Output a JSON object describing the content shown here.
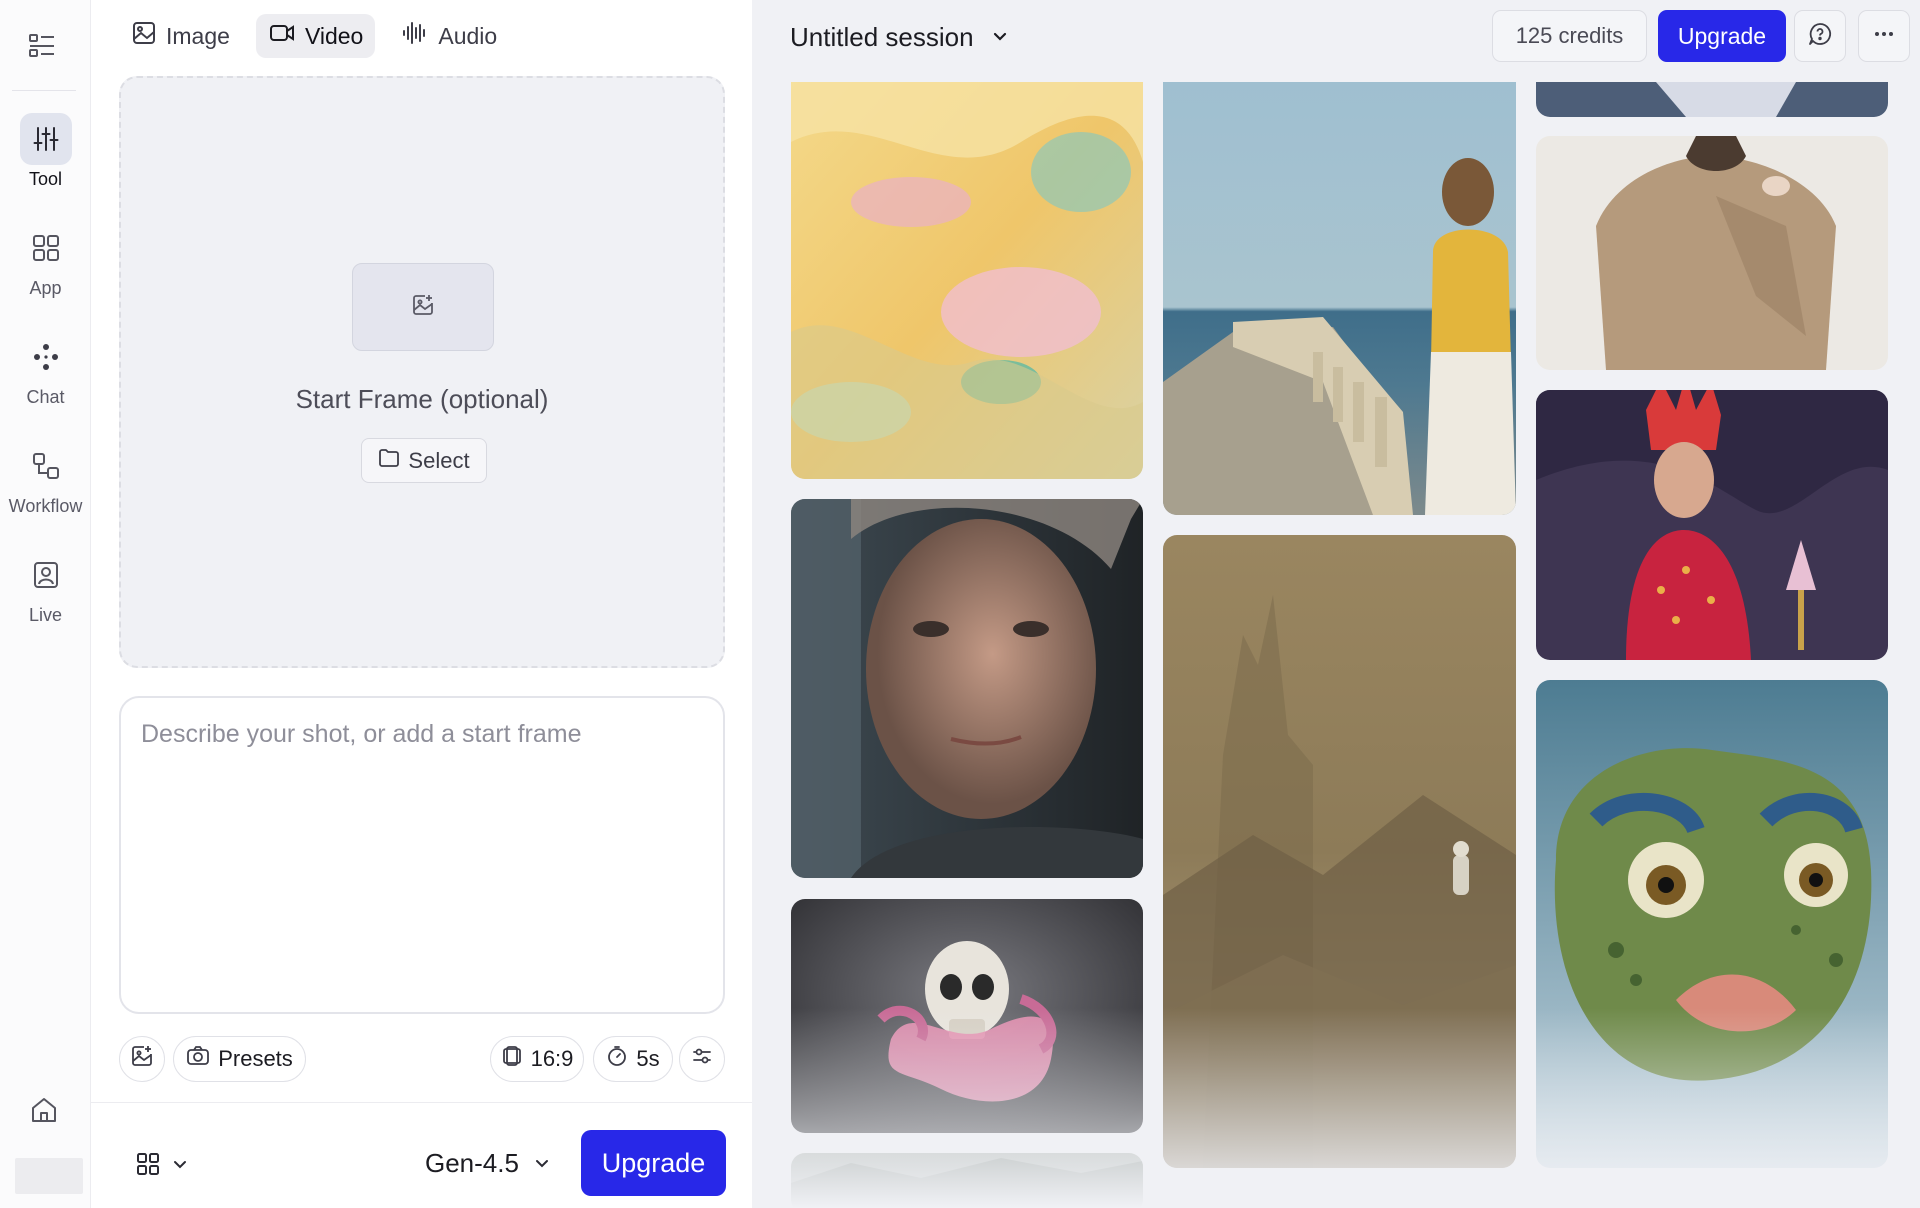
{
  "rail": {
    "toggle_icon": "sidebar-list-icon",
    "items": [
      {
        "label": "Tool",
        "icon": "sliders-icon",
        "active": true
      },
      {
        "label": "App",
        "icon": "grid-icon",
        "active": false
      },
      {
        "label": "Chat",
        "icon": "dots-icon",
        "active": false
      },
      {
        "label": "Workflow",
        "icon": "nodes-icon",
        "active": false
      },
      {
        "label": "Live",
        "icon": "portrait-icon",
        "active": false
      }
    ],
    "home_icon": "home-icon"
  },
  "panel": {
    "tabs": [
      {
        "label": "Image",
        "icon": "image-icon",
        "active": false
      },
      {
        "label": "Video",
        "icon": "video-icon",
        "active": true
      },
      {
        "label": "Audio",
        "icon": "waveform-icon",
        "active": false
      }
    ],
    "frame": {
      "label": "Start Frame (optional)",
      "select_label": "Select"
    },
    "prompt": {
      "placeholder": "Describe your shot, or add a start frame",
      "value": ""
    },
    "chips": {
      "presets": "Presets",
      "aspect_ratio": "16:9",
      "duration": "5s"
    },
    "model": "Gen-4.5",
    "upgrade": "Upgrade"
  },
  "header": {
    "session_title": "Untitled session",
    "credits": "125 credits",
    "upgrade": "Upgrade"
  },
  "colors": {
    "accent": "#2828e8",
    "workspace_bg": "#f0f1f5",
    "panel_bg": "#ffffff",
    "rail_bg": "#fbfbfc"
  },
  "gallery": [
    {
      "name": "pastel-fabric",
      "subject": "yellow and pink pastel fabric swirls"
    },
    {
      "name": "seaside-balustrade",
      "subject": "woman in yellow top on seaside balustrade"
    },
    {
      "name": "knit-sweater",
      "subject": "woman in beige knit sweater"
    },
    {
      "name": "elderly-woman",
      "subject": "elderly woman portrait by rainy window"
    },
    {
      "name": "foggy-canyon",
      "subject": "astronaut in foggy canyon"
    },
    {
      "name": "sequin-queen",
      "subject": "woman with red crown and sequin gown"
    },
    {
      "name": "skull-brain",
      "subject": "skull wrapped in pink brain coil"
    },
    {
      "name": "frog-face",
      "subject": "painted frog creature face"
    }
  ]
}
